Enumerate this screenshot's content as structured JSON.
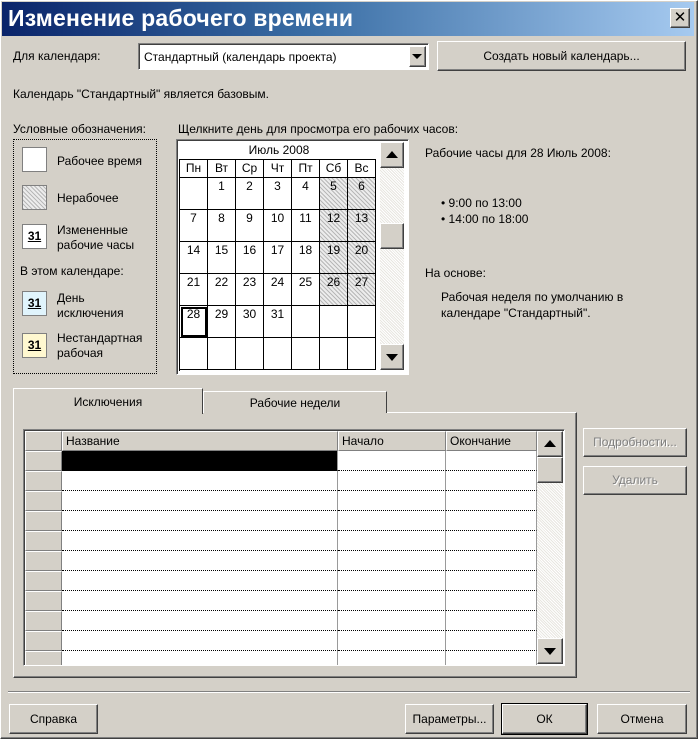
{
  "window": {
    "title": "Изменение рабочего времени",
    "close_glyph": "✕"
  },
  "calendar_select": {
    "label": "Для календаря:",
    "value": "Стандартный (календарь проекта)"
  },
  "create_calendar_button": "Создать новый календарь...",
  "base_note": "Календарь \"Стандартный\" является базовым.",
  "legend": {
    "title": "Условные обозначения:",
    "items": [
      {
        "label": "Рабочее время",
        "badge": ""
      },
      {
        "label": "Нерабочее",
        "badge": ""
      },
      {
        "label": "Измененные рабочие часы",
        "badge": "31"
      }
    ],
    "in_calendar_title": "В этом календаре:",
    "calendar_items": [
      {
        "label": "День исключения",
        "badge": "31"
      },
      {
        "label": "Нестандартная рабочая",
        "badge": "31"
      }
    ]
  },
  "calendar": {
    "instruction": "Щелкните день для просмотра его рабочих часов:",
    "month": "Июль 2008",
    "weekdays": [
      "Пн",
      "Вт",
      "Ср",
      "Чт",
      "Пт",
      "Сб",
      "Вс"
    ],
    "weeks": [
      [
        "",
        "1",
        "2",
        "3",
        "4",
        "5",
        "6"
      ],
      [
        "7",
        "8",
        "9",
        "10",
        "11",
        "12",
        "13"
      ],
      [
        "14",
        "15",
        "16",
        "17",
        "18",
        "19",
        "20"
      ],
      [
        "21",
        "22",
        "23",
        "24",
        "25",
        "26",
        "27"
      ],
      [
        "28",
        "29",
        "30",
        "31",
        "",
        "",
        ""
      ],
      [
        "",
        "",
        "",
        "",
        "",
        "",
        ""
      ]
    ],
    "selected_day": "28"
  },
  "info": {
    "hours_title": "Рабочие часы для 28 Июль 2008:",
    "hours": [
      "9:00 по 13:00",
      "14:00 по 18:00"
    ],
    "based_on_title": "На основе:",
    "based_on_text": "Рабочая неделя по умолчанию в календаре \"Стандартный\"."
  },
  "tabs": [
    {
      "label": "Исключения",
      "active": true
    },
    {
      "label": "Рабочие недели",
      "active": false
    }
  ],
  "exceptions_table": {
    "columns": [
      "Название",
      "Начало",
      "Окончание"
    ],
    "row_count": 11
  },
  "side_buttons": {
    "details": "Подробности...",
    "delete": "Удалить"
  },
  "footer": {
    "help": "Справка",
    "options": "Параметры...",
    "ok": "ОК",
    "cancel": "Отмена"
  },
  "colors": {
    "title_start": "#0a246a",
    "title_end": "#a6caf0",
    "exception_bg": "#e0f4fc",
    "nondefault_bg": "#fff8d0"
  }
}
